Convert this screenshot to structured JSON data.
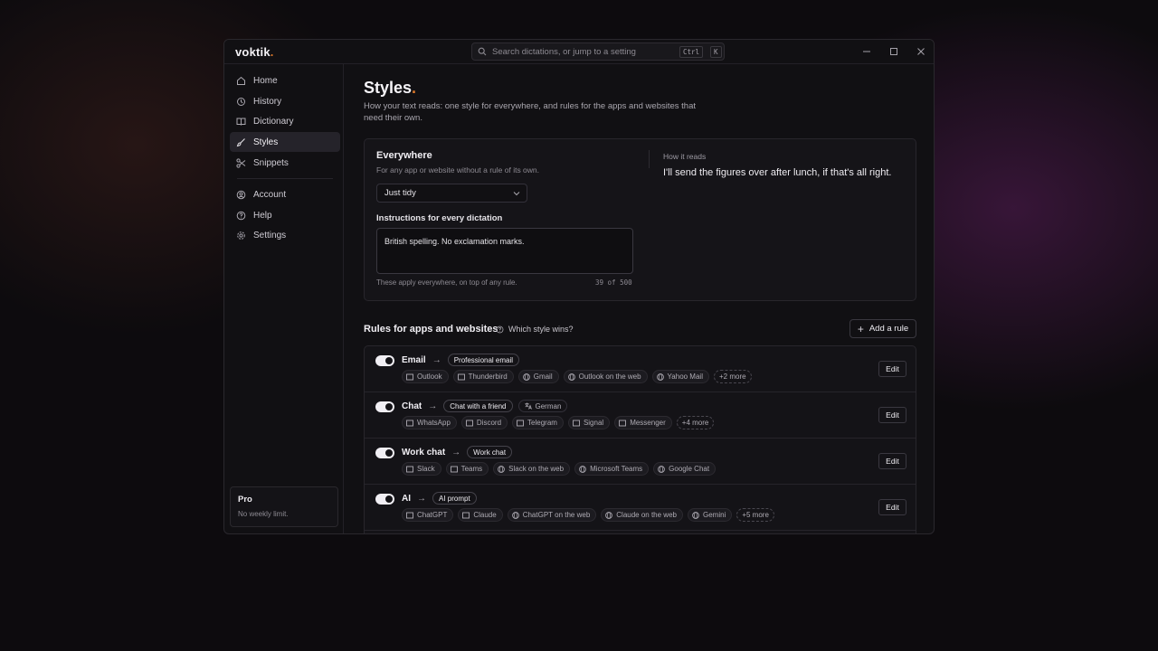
{
  "app": {
    "logo": "voktik",
    "logo_dot": "."
  },
  "search": {
    "placeholder": "Search dictations, or jump to a setting",
    "kbd_ctrl": "Ctrl",
    "kbd_k": "K"
  },
  "sidebar": {
    "items": [
      {
        "label": "Home",
        "icon": "home-icon"
      },
      {
        "label": "History",
        "icon": "history-icon"
      },
      {
        "label": "Dictionary",
        "icon": "book-icon"
      },
      {
        "label": "Styles",
        "icon": "brush-icon",
        "active": true
      },
      {
        "label": "Snippets",
        "icon": "scissors-icon"
      },
      {
        "label": "Account",
        "icon": "account-icon"
      },
      {
        "label": "Help",
        "icon": "help-icon"
      },
      {
        "label": "Settings",
        "icon": "gear-icon"
      }
    ],
    "plan": {
      "title": "Pro",
      "subtitle": "No weekly limit."
    }
  },
  "page": {
    "title": "Styles",
    "title_dot": ".",
    "description": "How your text reads: one style for everywhere, and rules for the apps and websites that need their own."
  },
  "everywhere": {
    "title": "Everywhere",
    "subtitle": "For any app or website without a rule of its own.",
    "selected_style": "Just tidy",
    "instructions_label": "Instructions for every dictation",
    "instructions_value": "British spelling. No exclamation marks.",
    "note": "These apply everywhere, on top of any rule.",
    "counter": "39 of 500",
    "preview_label": "How it reads",
    "preview_text": "I'll send the figures over after lunch, if that's all right."
  },
  "rules": {
    "title": "Rules for apps and websites",
    "which_label": "Which style wins?",
    "add_label": "Add a rule",
    "edit_label": "Edit",
    "arrow": "→",
    "items": [
      {
        "name": "Email",
        "style": "Professional email",
        "enabled": true,
        "apps": [
          {
            "label": "Outlook",
            "kind": "app"
          },
          {
            "label": "Thunderbird",
            "kind": "app"
          },
          {
            "label": "Gmail",
            "kind": "web"
          },
          {
            "label": "Outlook on the web",
            "kind": "web"
          },
          {
            "label": "Yahoo Mail",
            "kind": "web"
          }
        ],
        "more": "+2 more"
      },
      {
        "name": "Chat",
        "style": "Chat with a friend",
        "language": "German",
        "enabled": true,
        "apps": [
          {
            "label": "WhatsApp",
            "kind": "app"
          },
          {
            "label": "Discord",
            "kind": "app"
          },
          {
            "label": "Telegram",
            "kind": "app"
          },
          {
            "label": "Signal",
            "kind": "app"
          },
          {
            "label": "Messenger",
            "kind": "app"
          }
        ],
        "more": "+4 more"
      },
      {
        "name": "Work chat",
        "style": "Work chat",
        "enabled": true,
        "apps": [
          {
            "label": "Slack",
            "kind": "app"
          },
          {
            "label": "Teams",
            "kind": "app"
          },
          {
            "label": "Slack on the web",
            "kind": "web"
          },
          {
            "label": "Microsoft Teams",
            "kind": "web"
          },
          {
            "label": "Google Chat",
            "kind": "web"
          }
        ]
      },
      {
        "name": "AI",
        "style": "AI prompt",
        "enabled": true,
        "apps": [
          {
            "label": "ChatGPT",
            "kind": "app"
          },
          {
            "label": "Claude",
            "kind": "app"
          },
          {
            "label": "ChatGPT on the web",
            "kind": "web"
          },
          {
            "label": "Claude on the web",
            "kind": "web"
          },
          {
            "label": "Gemini",
            "kind": "web"
          }
        ],
        "more": "+5 more"
      }
    ]
  },
  "colors": {
    "accent": "#d9772b",
    "background": "#111013",
    "surface": "#151418"
  }
}
